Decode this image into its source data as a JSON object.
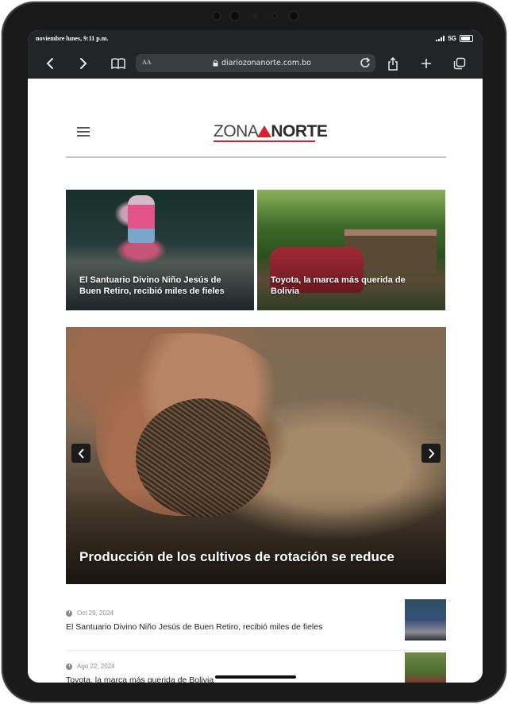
{
  "status": {
    "time": "noviembre lunes, 9:11 p.m.",
    "network": "5G"
  },
  "browser": {
    "text_size_label": "AA",
    "url": "diariozonanorte.com.bo"
  },
  "site": {
    "logo_left": "ZONA",
    "logo_right": "NORTE"
  },
  "cards": [
    {
      "title": "El Santuario Divino Niño Jesús de Buen Retiro, recibió miles de fieles"
    },
    {
      "title": "Toyota, la marca más querida de Bolivia"
    }
  ],
  "hero": {
    "title": "Producción de los cultivos de rotación se reduce"
  },
  "news_list": [
    {
      "date": "Oct 29, 2024",
      "title": "El Santuario Divino Niño Jesús de Buen Retiro, recibió miles de fieles"
    },
    {
      "date": "Ago 22, 2024",
      "title": "Toyota, la marca más querida de Bolivia"
    }
  ],
  "icons": {
    "back": "chevron-left-icon",
    "forward": "chevron-right-icon",
    "bookmarks": "book-icon",
    "share": "share-icon",
    "new_tab": "plus-icon",
    "tabs": "tabs-icon",
    "menu": "hamburger-icon",
    "date": "clock-icon"
  },
  "colors": {
    "browser_chrome": "#232427",
    "url_bar": "#3b3c40",
    "logo_red": "#d6232b",
    "date_gray": "#8b8b96"
  }
}
